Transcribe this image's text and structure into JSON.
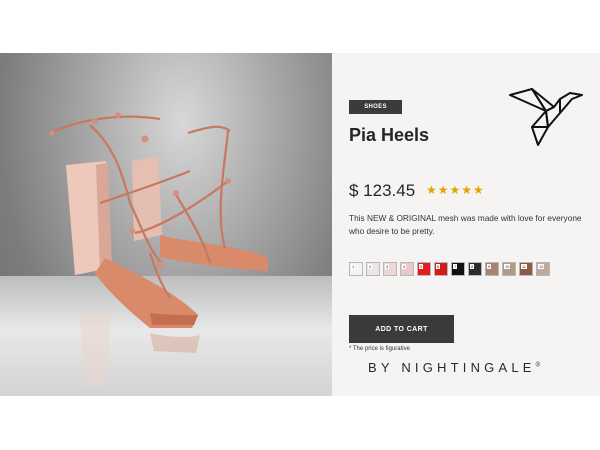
{
  "product": {
    "badge": "SHOES",
    "title": "Pia Heels",
    "price": "$ 123.45",
    "rating": {
      "stars": 5,
      "glyphs": "★★★★★"
    },
    "description": "This NEW & ORIGINAL mesh was made with love for everyone who desire to be pretty.",
    "cta_label": "ADD TO CART",
    "note": "* The price is figurative",
    "brand": "BY NIGHTINGALE",
    "brand_mark": "®"
  },
  "swatches": [
    {
      "num": "1",
      "color": "#f3f3f3"
    },
    {
      "num": "2",
      "color": "#ebe5e5"
    },
    {
      "num": "3",
      "color": "#efd6d6"
    },
    {
      "num": "4",
      "color": "#e8c9c9"
    },
    {
      "num": "5",
      "color": "#e02020"
    },
    {
      "num": "6",
      "color": "#d61a1a"
    },
    {
      "num": "7",
      "color": "#111111"
    },
    {
      "num": "8",
      "color": "#2b2b2b"
    },
    {
      "num": "9",
      "color": "#a88470"
    },
    {
      "num": "10",
      "color": "#b59a82"
    },
    {
      "num": "11",
      "color": "#8b5a45"
    },
    {
      "num": "12",
      "color": "#bfa99a"
    }
  ],
  "colors": {
    "accent": "#3a3a3a",
    "star": "#e2a400",
    "shoe": "#d98a6a"
  },
  "icons": {
    "logo": "origami-bird-icon",
    "photo": "pink-heels-photo"
  }
}
